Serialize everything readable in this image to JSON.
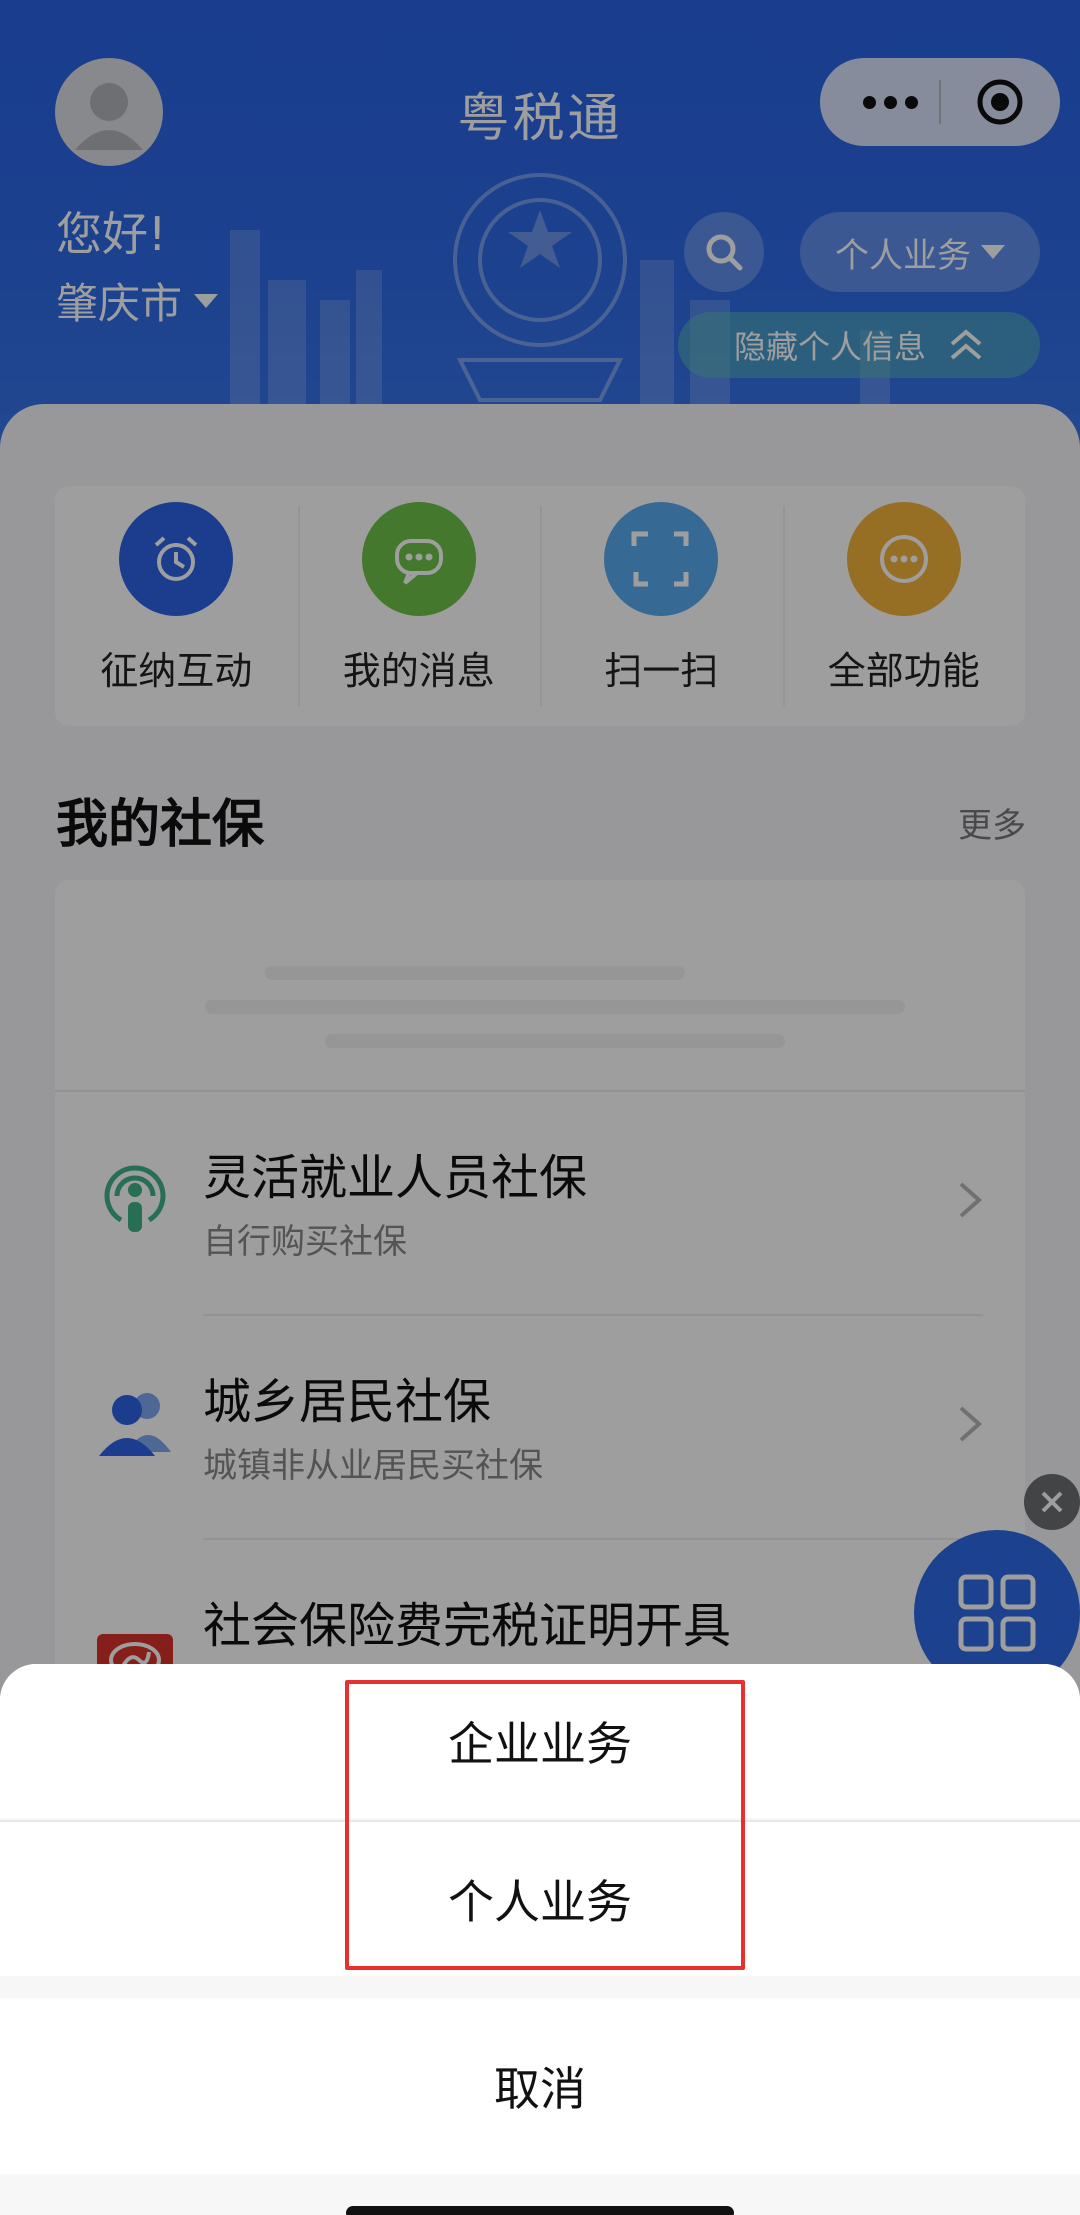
{
  "header": {
    "title": "粤税通",
    "greeting": "您好!",
    "city": "肇庆市",
    "business_label": "个人业务",
    "hide_info_label": "隐藏个人信息"
  },
  "quick_actions": [
    {
      "label": "征纳互动",
      "icon": "alarm-clock-icon",
      "color": "#2e63e6"
    },
    {
      "label": "我的消息",
      "icon": "chat-bubble-icon",
      "color": "#6cc24a"
    },
    {
      "label": "扫一扫",
      "icon": "scan-icon",
      "color": "#5aaaf0"
    },
    {
      "label": "全部功能",
      "icon": "more-circle-icon",
      "color": "#f2b43b"
    }
  ],
  "social": {
    "title": "我的社保",
    "more": "更多",
    "items": [
      {
        "title": "灵活就业人员社保",
        "subtitle": "自行购买社保",
        "icon": "broadcast-person-icon"
      },
      {
        "title": "城乡居民社保",
        "subtitle": "城镇非从业居民买社保",
        "icon": "people-icon"
      },
      {
        "title": "社会保险费完税证明开具",
        "subtitle": "",
        "icon": "social-insurance-logo-icon"
      }
    ]
  },
  "action_sheet": {
    "options": [
      "企业业务",
      "个人业务"
    ],
    "cancel": "取消"
  },
  "colors": {
    "brand_blue": "#2e6ae6",
    "highlight_red": "#e8312f"
  }
}
